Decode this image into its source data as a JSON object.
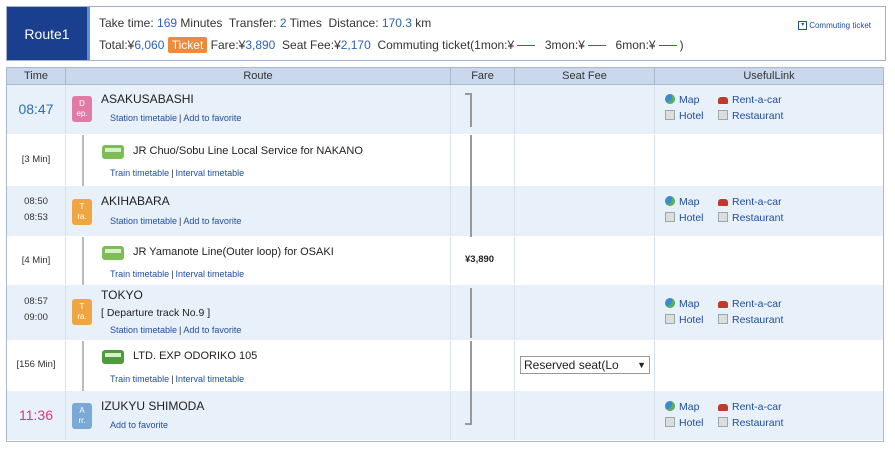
{
  "route_tab": "Route1",
  "summary": {
    "take_time_label": "Take time:",
    "take_time_value": "169",
    "take_time_unit": "Minutes",
    "transfer_label": "Transfer:",
    "transfer_value": "2",
    "transfer_unit": "Times",
    "distance_label": "Distance:",
    "distance_value": "170.3",
    "distance_unit": "km",
    "total_label": "Total:¥",
    "total_value": "6,060",
    "ticket_badge": "Ticket",
    "fare_label": "Fare:¥",
    "fare_value": "3,890",
    "seat_fee_label": "Seat Fee:¥",
    "seat_fee_value": "2,170",
    "commuting_text": "Commuting ticket(1mon:¥",
    "commuting_3mon": "3mon:¥",
    "commuting_6mon": "6mon:¥",
    "close_paren": ")",
    "commuting_link": "Commuting ticket"
  },
  "columns": {
    "time": "Time",
    "route": "Route",
    "fare": "Fare",
    "seat_fee": "Seat Fee",
    "useful_link": "UsefulLink"
  },
  "rows": {
    "r0": {
      "time": "08:47",
      "badge_top": "D",
      "badge_bottom": "ep.",
      "station": "ASAKUSABASHI",
      "link1": "Station timetable",
      "link2": "Add to favorite"
    },
    "r1": {
      "duration": "[3 Min]",
      "line": "JR Chuo/Sobu Line Local Service  for NAKANO",
      "link1": "Train timetable",
      "link2": "Interval timetable"
    },
    "r2": {
      "time1": "08:50",
      "time2": "08:53",
      "badge_top": "T",
      "badge_bottom": "ra.",
      "station": "AKIHABARA",
      "link1": "Station timetable",
      "link2": "Add to favorite"
    },
    "r3": {
      "duration": "[4 Min]",
      "line": "JR Yamanote Line(Outer loop)  for OSAKI",
      "fare": "¥3,890",
      "link1": "Train timetable",
      "link2": "Interval timetable"
    },
    "r4": {
      "time1": "08:57",
      "time2": "09:00",
      "badge_top": "T",
      "badge_bottom": "ra.",
      "station": "TOKYO",
      "track": "[ Departure track No.9 ]",
      "link1": "Station timetable",
      "link2": "Add to favorite"
    },
    "r5": {
      "duration": "[156 Min]",
      "line": "LTD. EXP ODORIKO 105",
      "seat_select": "Reserved seat(Lo",
      "link1": "Train timetable",
      "link2": "Interval timetable"
    },
    "r6": {
      "time": "11:36",
      "badge_top": "A",
      "badge_bottom": "rr.",
      "station": "IZUKYU SHIMODA",
      "link1": "Add to favorite"
    }
  },
  "useful": {
    "map": "Map",
    "rentacar": "Rent-a-car",
    "hotel": "Hotel",
    "restaurant": "Restaurant"
  },
  "separator": "|",
  "colors": {
    "route_tab_bg": "#1a3f8f",
    "header_blue": "#2b62b8",
    "ticket_orange": "#f08a3a",
    "arrival_pink": "#e0338a",
    "station_row_bg": "#e8f0fa"
  },
  "icons": [
    "globe-icon",
    "car-icon",
    "hotel-icon",
    "restaurant-icon",
    "train-icon",
    "commuting-ticket-icon"
  ]
}
